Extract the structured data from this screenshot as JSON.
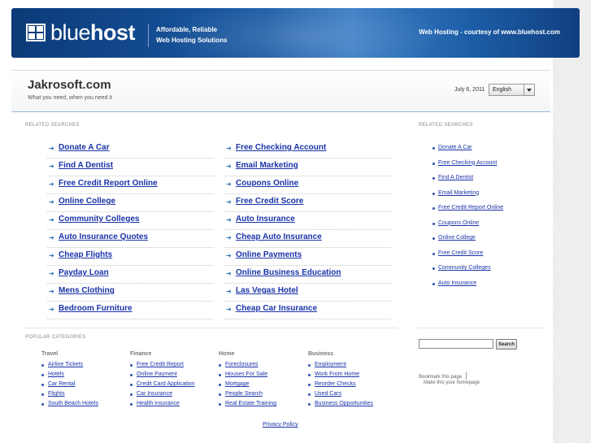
{
  "banner": {
    "brand_light": "blue",
    "brand_bold": "host",
    "tagline_line1": "Affordable, Reliable",
    "tagline_line2": "Web Hosting Solutions",
    "courtesy": "Web Hosting - courtesy of www.bluehost.com"
  },
  "site": {
    "title": "Jakrosoft.com",
    "subtitle": "What you need, when you need it",
    "date": "July 6, 2011",
    "language": "English"
  },
  "related": {
    "label": "RELATED SEARCHES",
    "rows": [
      [
        "Donate A Car",
        "Free Checking Account"
      ],
      [
        "Find A Dentist",
        "Email Marketing"
      ],
      [
        "Free Credit Report Online",
        "Coupons Online"
      ],
      [
        "Online College",
        "Free Credit Score"
      ],
      [
        "Community Colleges",
        "Auto Insurance"
      ],
      [
        "Auto Insurance Quotes",
        "Cheap Auto Insurance"
      ],
      [
        "Cheap Flights",
        "Online Payments"
      ],
      [
        "Payday Loan",
        "Online Business Education"
      ],
      [
        "Mens Clothing",
        "Las Vegas Hotel"
      ],
      [
        "Bedroom Furniture",
        "Cheap Car Insurance"
      ]
    ]
  },
  "sidebar": {
    "label": "RELATED SEARCHES",
    "items": [
      "Donate A Car",
      "Free Checking Account",
      "Find A Dentist",
      "Email Marketing",
      "Free Credit Report Online",
      "Coupons Online",
      "Online College",
      "Free Credit Score",
      "Community Colleges",
      "Auto Insurance"
    ],
    "search_button": "Search",
    "bookmark": "Bookmark this page",
    "homepage": "Make this your homepage"
  },
  "popular": {
    "label": "POPULAR CATEGORIES",
    "categories": [
      {
        "name": "Travel",
        "items": [
          "Airline Tickets",
          "Hotels",
          "Car Rental",
          "Flights",
          "South Beach Hotels"
        ]
      },
      {
        "name": "Finance",
        "items": [
          "Free Credit Report",
          "Online Payment",
          "Credit Card Application",
          "Car Insurance",
          "Health Insurance"
        ]
      },
      {
        "name": "Home",
        "items": [
          "Foreclosures",
          "Houses For Sale",
          "Mortgage",
          "People Search",
          "Real Estate Training"
        ]
      },
      {
        "name": "Business",
        "items": [
          "Employment",
          "Work From Home",
          "Reorder Checks",
          "Used Cars",
          "Business Opportunities"
        ]
      }
    ]
  },
  "footer": {
    "privacy": "Privacy Policy"
  },
  "icons": {
    "arrow": "right-arrow-icon",
    "bullet": "bullet-icon",
    "logo": "bluehost-grid-icon",
    "dropdown": "chevron-down-icon"
  },
  "colors": {
    "link": "#1a33a8",
    "banner": "#1a5aa4",
    "arrow": "#2a6fb3"
  }
}
